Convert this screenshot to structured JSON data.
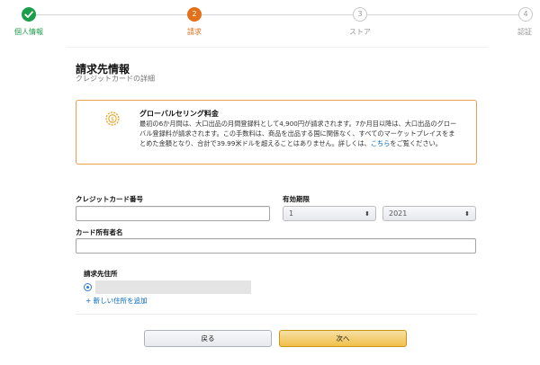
{
  "stepper": {
    "steps": [
      {
        "number": "",
        "label": "個人情報",
        "state": "done"
      },
      {
        "number": "2",
        "label": "請求",
        "state": "active"
      },
      {
        "number": "3",
        "label": "ストア",
        "state": "future"
      },
      {
        "number": "4",
        "label": "認証",
        "state": "future"
      }
    ]
  },
  "page": {
    "title": "請求先情報",
    "subtitle": "クレジットカードの詳細"
  },
  "alert": {
    "icon": "coin-settings-icon",
    "title": "グローバルセリング料金",
    "body": "最初の6か月間は、大口出品の月間登録料として4,900円が請求されます。7か月目以降は、大口出品のグローバル登録料が請求されます。この手数料は、商品を出品する国に関係なく、すべてのマーケットプレイスをまとめた金額となり、合計で39.99米ドルを超えることはありません。詳しくは、",
    "link": "こちら",
    "suffix": "をご覧ください。"
  },
  "form": {
    "card_number_label": "クレジットカード番号",
    "card_number_value": "",
    "expiry_label": "有効期限",
    "expiry_month": "1",
    "expiry_year": "2021",
    "holder_label": "カード所有者名",
    "holder_value": ""
  },
  "address": {
    "heading": "請求先住所",
    "add_new": "+ 新しい住所を追加"
  },
  "buttons": {
    "back": "戻る",
    "next": "次へ"
  },
  "colors": {
    "done": "#1a9e4a",
    "active": "#e3701a",
    "alert_border": "#e8a24d",
    "link": "#0066c0",
    "primary_button": "#f0c14b"
  }
}
